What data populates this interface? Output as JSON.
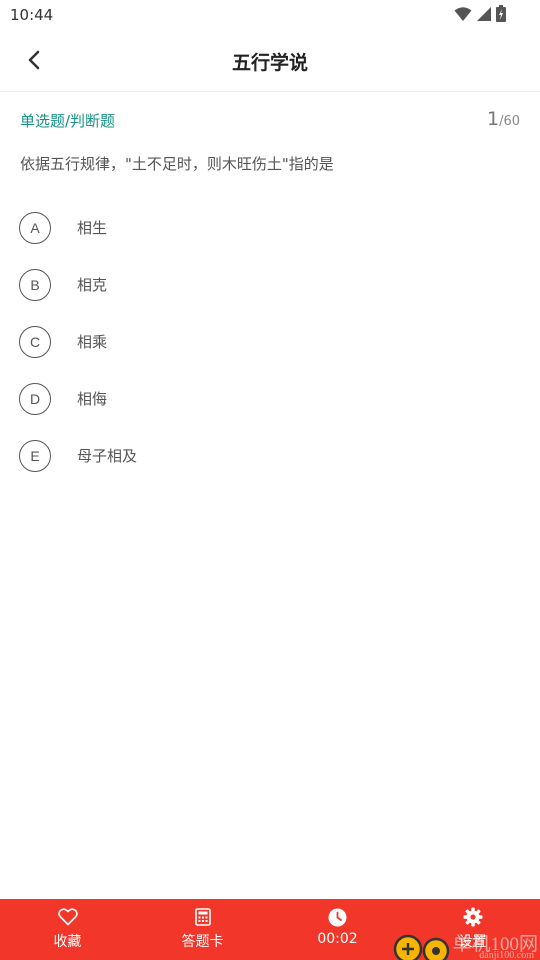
{
  "status_bar": {
    "time": "10:44"
  },
  "header": {
    "title": "五行学说"
  },
  "question": {
    "type_label": "单选题/判断题",
    "current": "1",
    "total": "/60",
    "text": "依据五行规律，\"土不足时，则木旺伤土\"指的是",
    "options": [
      {
        "letter": "A",
        "text": "相生"
      },
      {
        "letter": "B",
        "text": "相克"
      },
      {
        "letter": "C",
        "text": "相乘"
      },
      {
        "letter": "D",
        "text": "相侮"
      },
      {
        "letter": "E",
        "text": "母子相及"
      }
    ]
  },
  "bottom_bar": {
    "favorite_label": "收藏",
    "answer_card_label": "答题卡",
    "timer": "00:02",
    "settings_label": "设置"
  },
  "watermark": {
    "text": "单机100网",
    "sub": "danji100.com"
  },
  "colors": {
    "accent": "#1a9185",
    "bottom_bar": "#f2372a"
  }
}
